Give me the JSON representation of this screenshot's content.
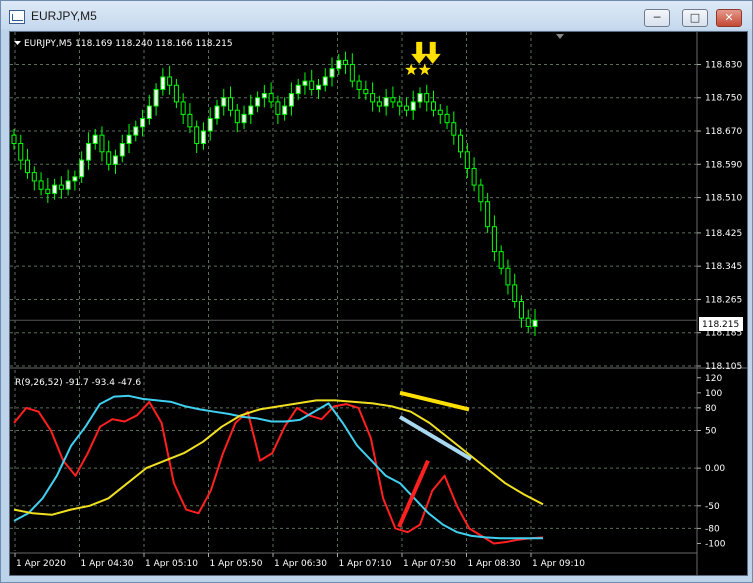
{
  "window": {
    "title": "EURJPY,M5",
    "minimize_label": "─",
    "restore_label": "□",
    "close_label": "✕",
    "icon": "chart-window-icon"
  },
  "main_chart": {
    "header": "EURJPY,M5  118.169 118.240 118.166 118.215",
    "price_labels": [
      "118.830",
      "118.750",
      "118.670",
      "118.590",
      "118.510",
      "118.425",
      "118.345",
      "118.265",
      "118.185",
      "118.105"
    ],
    "current_price": "118.215"
  },
  "indicator": {
    "header": "R(9,26,52) -91.7 -93.4 -47.6",
    "levels": [
      "120",
      "100",
      "80",
      "50",
      "0.00",
      "-50",
      "-80",
      "-100"
    ]
  },
  "time_axis": {
    "labels": [
      "1 Apr 2020",
      "1 Apr 04:30",
      "1 Apr 05:10",
      "1 Apr 05:50",
      "1 Apr 06:30",
      "1 Apr 07:10",
      "1 Apr 07:50",
      "1 Apr 08:30",
      "1 Apr 09:10"
    ]
  },
  "colors": {
    "background": "#000000",
    "grid": "#5a6e5a",
    "bull_candle": "#ffffff",
    "candle_outline": "#00ff00",
    "bear_candle": "#000000",
    "text": "#ffffff",
    "series_fast": "#ff2020",
    "series_mid": "#40d0f0",
    "series_slow": "#f0e020",
    "arrow": "#ffe000"
  },
  "chart_data": [
    {
      "type": "candlestick",
      "symbol": "EURJPY",
      "timeframe": "M5",
      "title": "EURJPY,M5",
      "ohlc_header": [
        118.169,
        118.24,
        118.166,
        118.215
      ],
      "ylim": [
        118.105,
        118.86
      ],
      "x_tick_labels": [
        "1 Apr 2020",
        "1 Apr 04:30",
        "1 Apr 05:10",
        "1 Apr 05:50",
        "1 Apr 06:30",
        "1 Apr 07:10",
        "1 Apr 07:50",
        "1 Apr 08:30",
        "1 Apr 09:10"
      ],
      "close": [
        118.64,
        118.6,
        118.57,
        118.55,
        118.53,
        118.52,
        118.54,
        118.53,
        118.55,
        118.56,
        118.6,
        118.64,
        118.66,
        118.62,
        118.59,
        118.61,
        118.64,
        118.66,
        118.68,
        118.7,
        118.73,
        118.77,
        118.8,
        118.78,
        118.74,
        118.71,
        118.68,
        118.64,
        118.67,
        118.7,
        118.73,
        118.75,
        118.72,
        118.69,
        118.71,
        118.73,
        118.75,
        118.76,
        118.74,
        118.71,
        118.73,
        118.76,
        118.78,
        118.79,
        118.77,
        118.78,
        118.8,
        118.82,
        118.84,
        118.83,
        118.79,
        118.77,
        118.76,
        118.74,
        118.73,
        118.75,
        118.74,
        118.73,
        118.72,
        118.74,
        118.76,
        118.74,
        118.72,
        118.71,
        118.69,
        118.66,
        118.62,
        118.58,
        118.54,
        118.5,
        118.44,
        118.38,
        118.34,
        118.3,
        118.26,
        118.22,
        118.2,
        118.215
      ],
      "signals": [
        {
          "type": "star-arrow",
          "index": 59
        },
        {
          "type": "star-arrow",
          "index": 61
        }
      ]
    },
    {
      "type": "line",
      "title": "R(9,26,52)",
      "header_values": [
        -91.7,
        -93.4,
        -47.6
      ],
      "ylim": [
        -110,
        125
      ],
      "y_ticks": [
        120,
        100,
        80,
        50,
        0,
        -50,
        -80,
        -100
      ],
      "series": [
        {
          "name": "R(9)",
          "values": [
            60,
            80,
            75,
            50,
            10,
            -10,
            20,
            55,
            65,
            62,
            70,
            88,
            60,
            -20,
            -55,
            -60,
            -30,
            20,
            60,
            75,
            10,
            20,
            55,
            80,
            70,
            65,
            82,
            85,
            80,
            40,
            -40,
            -80,
            -85,
            -75,
            -30,
            -10,
            -50,
            -80,
            -90,
            -100,
            -98,
            -95,
            -93,
            -92
          ]
        },
        {
          "name": "R(26)",
          "values": [
            -70,
            -60,
            -40,
            -10,
            30,
            55,
            85,
            95,
            96,
            92,
            90,
            88,
            82,
            78,
            75,
            72,
            68,
            66,
            62,
            62,
            64,
            75,
            86,
            60,
            30,
            10,
            -10,
            -20,
            -40,
            -60,
            -75,
            -85,
            -90,
            -92,
            -93,
            -93,
            -93,
            -93
          ]
        },
        {
          "name": "R(52)",
          "values": [
            -55,
            -60,
            -62,
            -55,
            -50,
            -40,
            -20,
            0,
            10,
            20,
            35,
            55,
            70,
            78,
            82,
            86,
            90,
            90,
            88,
            86,
            82,
            75,
            60,
            40,
            20,
            0,
            -20,
            -35,
            -48
          ]
        }
      ],
      "drawn_trendlines": [
        {
          "color": "yellow",
          "direction": "down"
        },
        {
          "color": "light-blue",
          "direction": "down"
        },
        {
          "color": "red",
          "direction": "up"
        }
      ]
    }
  ]
}
